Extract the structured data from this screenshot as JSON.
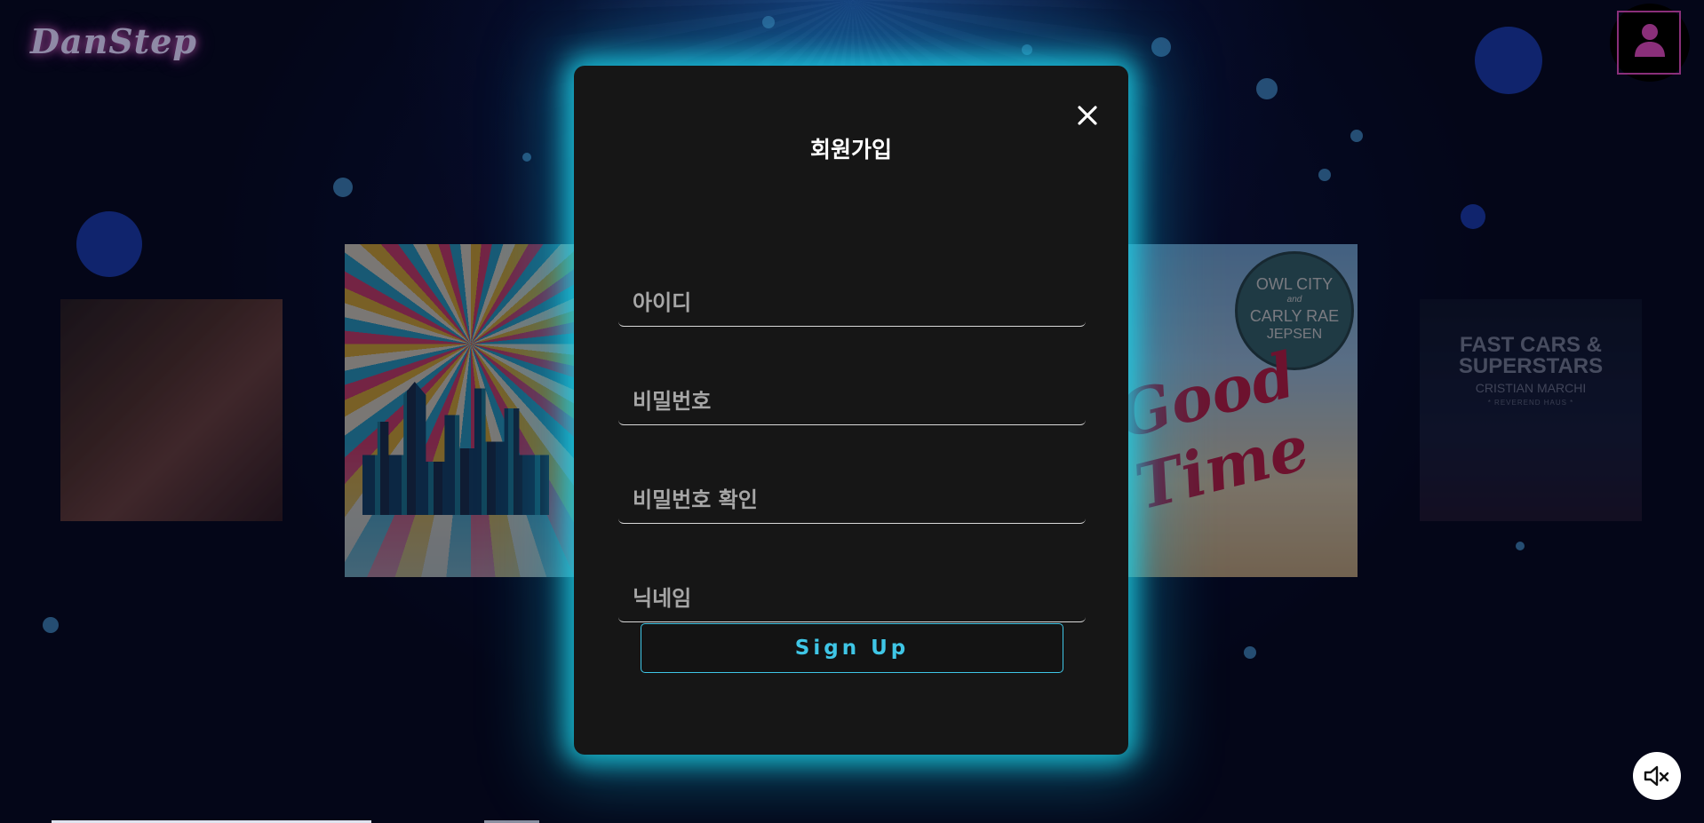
{
  "app": {
    "logo_text": "DanStep"
  },
  "background": {
    "covers": [
      {
        "name": "album-cover-1"
      },
      {
        "name": "album-cover-2"
      },
      {
        "name": "album-cover-3",
        "ring_line1": "OWL CITY",
        "ring_line2": "and",
        "ring_line3": "CARLY RAE",
        "ring_line4": "JEPSEN",
        "script": "Good Time"
      },
      {
        "name": "album-cover-4",
        "title": "FAST CARS & SUPERSTARS",
        "artist": "CRISTIAN MARCHI",
        "subtitle": "* REVEREND HAUS *"
      }
    ]
  },
  "header": {
    "profile_icon": "user-icon"
  },
  "signup_modal": {
    "title": "회원가입",
    "close_icon": "close-icon",
    "fields": {
      "id_placeholder": "아이디",
      "password_placeholder": "비밀번호",
      "password_confirm_placeholder": "비밀번호 확인",
      "nickname_placeholder": "닉네임"
    },
    "submit_label": "Sign Up"
  },
  "controls": {
    "sound_icon": "mute-speaker-icon"
  },
  "colors": {
    "accent": "#3fc6e6",
    "modal_bg": "#161616",
    "glow": "#1edcf0",
    "logo_glow": "#ff78dc",
    "profile_frame": "#8a2f7a"
  }
}
